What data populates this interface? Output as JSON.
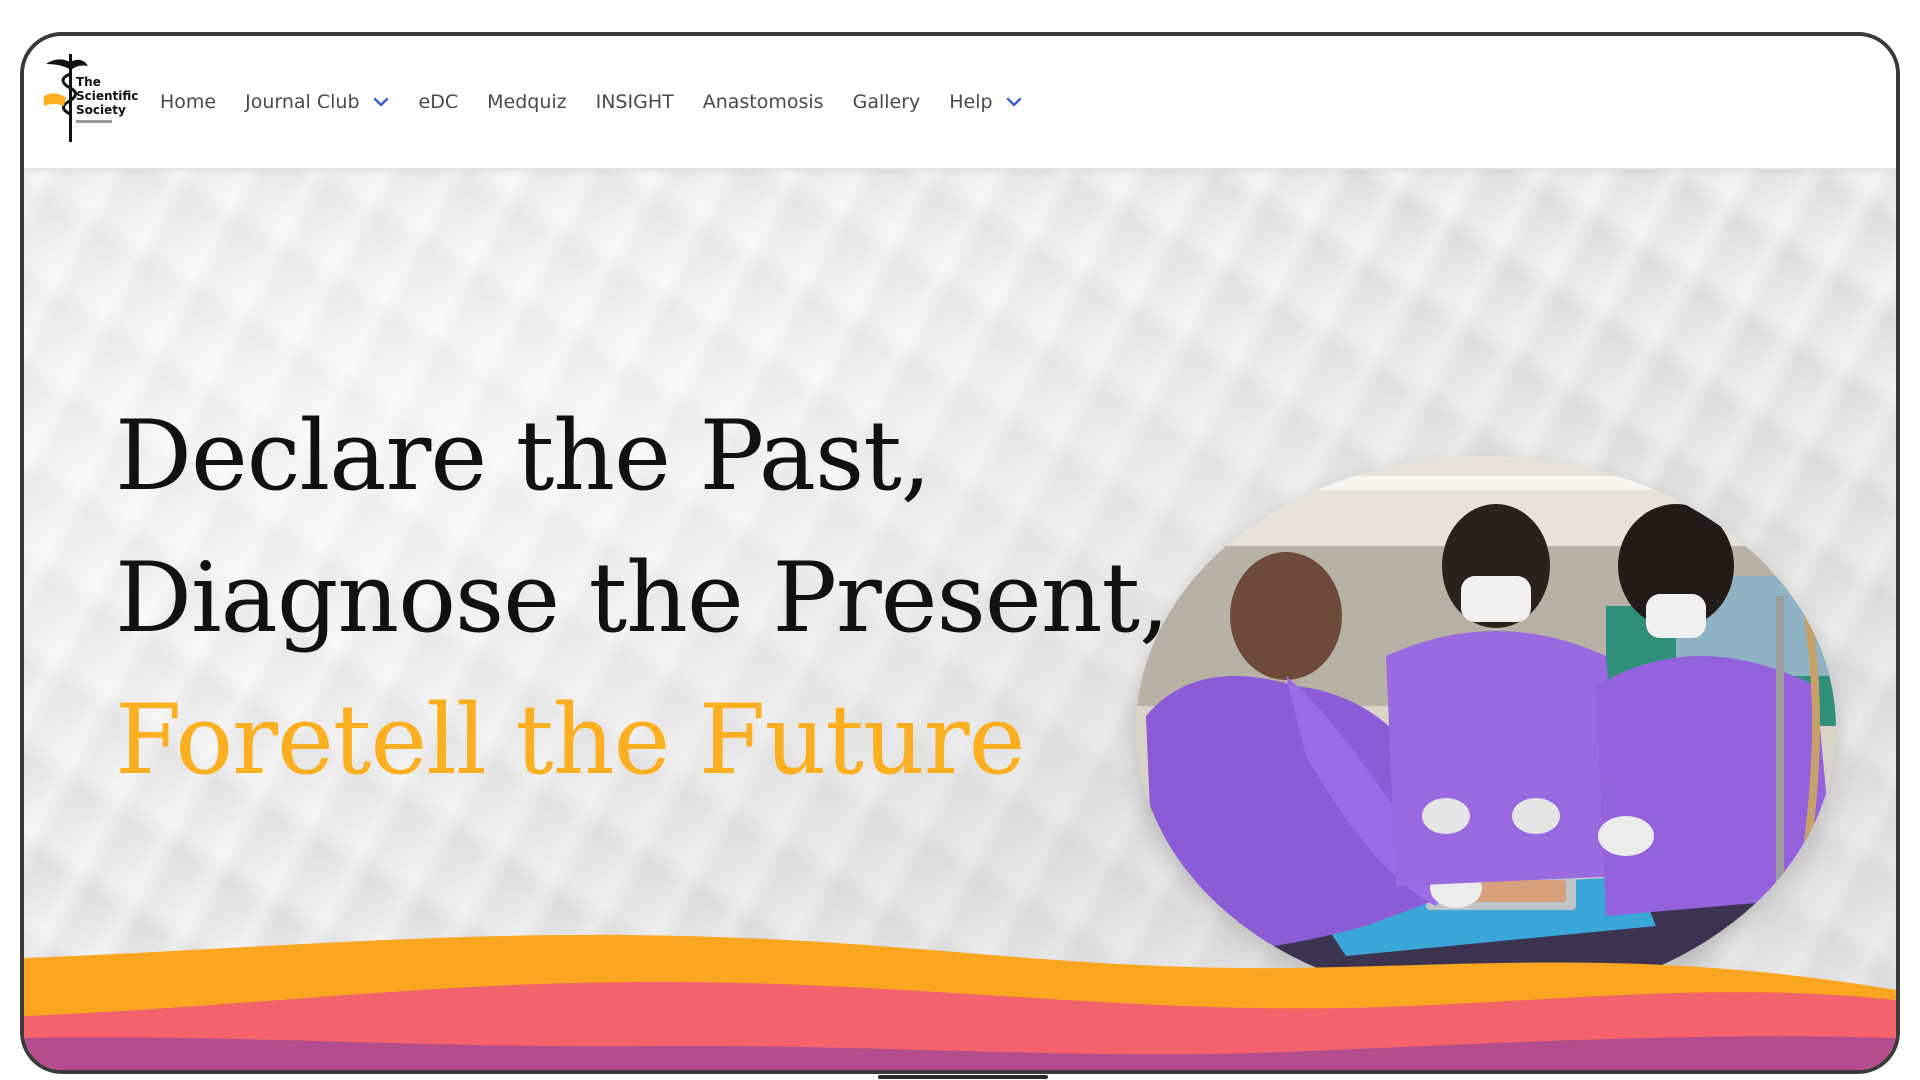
{
  "logo": {
    "line1": "The",
    "line2": "Scientific",
    "line3": "Society",
    "icon": "caduceus-icon"
  },
  "nav": {
    "items": [
      {
        "label": "Home",
        "dropdown": false
      },
      {
        "label": "Journal Club",
        "dropdown": true
      },
      {
        "label": "eDC",
        "dropdown": false
      },
      {
        "label": "Medquiz",
        "dropdown": false
      },
      {
        "label": "INSIGHT",
        "dropdown": false
      },
      {
        "label": "Anastomosis",
        "dropdown": false
      },
      {
        "label": "Gallery",
        "dropdown": false
      },
      {
        "label": "Help",
        "dropdown": true
      }
    ],
    "chevron_icon": "chevron-down-icon",
    "chevron_color": "#3b5bdb"
  },
  "hero": {
    "line1": "Declare the Past,",
    "line2": "Diagnose the Present,",
    "line3": "Foretell the Future",
    "accent_color": "#fcb021",
    "photo_subject": "dissection-photo"
  },
  "colors": {
    "wave_orange": "#fba620",
    "wave_coral": "#f4636c",
    "wave_purple": "#b44c8e",
    "headline": "#111111"
  }
}
